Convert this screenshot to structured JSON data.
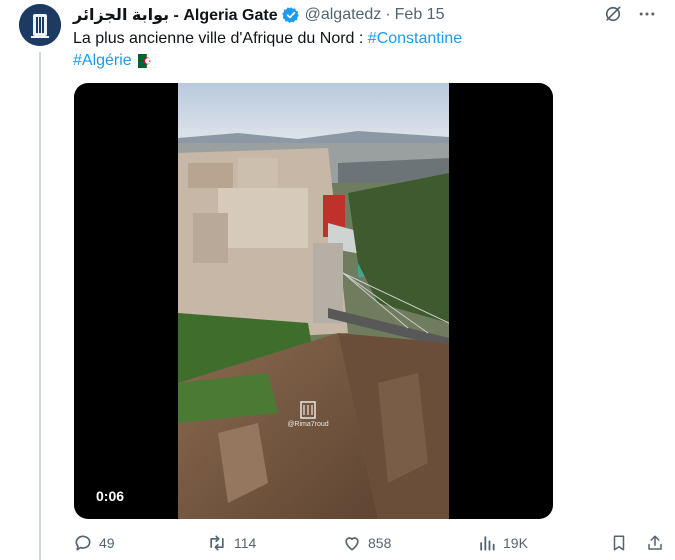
{
  "tweet": {
    "display_name": "بوابة الجزائر - Algeria Gate",
    "handle": "@algatedz",
    "separator": "·",
    "date": "Feb 15",
    "text_prefix": "La plus ancienne ville d'Afrique du Nord : ",
    "hashtag_1": "#Constantine",
    "hashtag_2": "#Algérie"
  },
  "media": {
    "duration": "0:06",
    "watermark": "@Rima7roud"
  },
  "actions": {
    "replies": "49",
    "reposts": "114",
    "likes": "858",
    "views": "19K"
  },
  "icons": [
    "grok-icon",
    "more-icon",
    "verified-icon",
    "algeria-flag-icon",
    "reply-icon",
    "repost-icon",
    "like-icon",
    "views-icon",
    "bookmark-icon",
    "share-icon"
  ],
  "colors": {
    "link": "#1d9bf0",
    "verified": "#1d9bf0",
    "muted": "#536471",
    "text": "#0f1419",
    "thread_line": "#cfd9de"
  }
}
